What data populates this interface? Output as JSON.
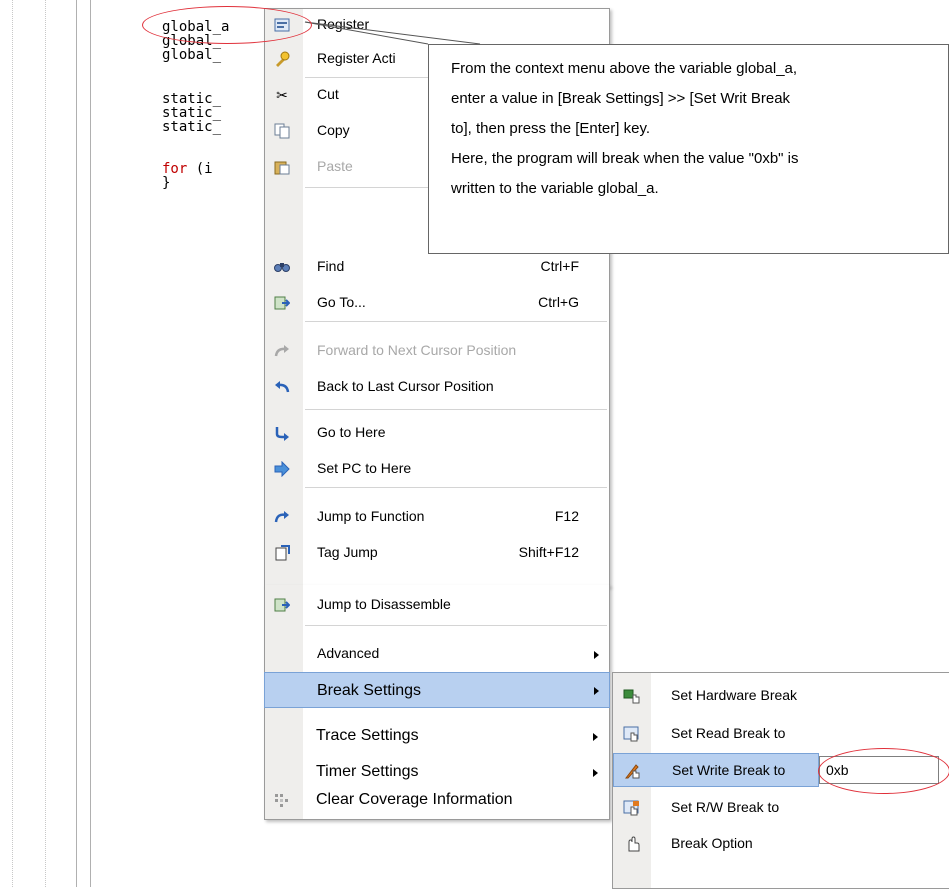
{
  "editor": {
    "code_lines": [
      "global_a",
      "global_",
      "global_",
      "",
      "static_",
      "static_",
      "static_",
      "",
      "for (i",
      "}"
    ],
    "for_keyword": "for",
    "for_rest": " (i"
  },
  "context_menu": {
    "items": [
      {
        "label": "Register",
        "shortcut": "",
        "icon": "register-watch-icon"
      },
      {
        "label": "Register Acti",
        "shortcut": "",
        "icon": "register-action-icon"
      },
      {
        "label": "Cut",
        "shortcut": "",
        "icon": "scissors-icon"
      },
      {
        "label": "Copy",
        "shortcut": "",
        "icon": "copy-icon"
      },
      {
        "label": "Paste",
        "shortcut": "",
        "icon": "paste-icon",
        "disabled": true
      },
      {
        "label": "Find",
        "shortcut": "Ctrl+F",
        "icon": "find-icon"
      },
      {
        "label": "Go To...",
        "shortcut": "Ctrl+G",
        "icon": "goto-icon"
      },
      {
        "label": "Forward to Next Cursor Position",
        "shortcut": "",
        "icon": "forward-arrow-icon",
        "disabled": true
      },
      {
        "label": "Back to Last Cursor Position",
        "shortcut": "",
        "icon": "back-arrow-icon"
      },
      {
        "label": "Go to Here",
        "shortcut": "",
        "icon": "go-here-icon"
      },
      {
        "label": "Set PC to Here",
        "shortcut": "",
        "icon": "set-pc-icon"
      },
      {
        "label": "Jump to Function",
        "shortcut": "F12",
        "icon": "jump-function-icon"
      },
      {
        "label": "Tag Jump",
        "shortcut": "Shift+F12",
        "icon": "tag-jump-icon"
      },
      {
        "label": "Jump to Disassemble",
        "shortcut": "",
        "icon": "disassemble-icon"
      },
      {
        "label": "Advanced",
        "shortcut": "",
        "icon": ""
      },
      {
        "label": "Break Settings",
        "shortcut": "",
        "icon": ""
      },
      {
        "label": "Trace Settings",
        "shortcut": "",
        "icon": ""
      },
      {
        "label": "Timer Settings",
        "shortcut": "",
        "icon": ""
      },
      {
        "label": "Clear Coverage Information",
        "shortcut": "",
        "icon": "clear-coverage-icon"
      }
    ]
  },
  "break_submenu": {
    "items": [
      {
        "label": "Set Hardware Break",
        "icon": "hardware-break-icon"
      },
      {
        "label": "Set Read Break to",
        "icon": "read-break-icon"
      },
      {
        "label": "Set Write Break to",
        "icon": "write-break-icon"
      },
      {
        "label": "Set R/W Break to",
        "icon": "rw-break-icon"
      },
      {
        "label": "Break Option",
        "icon": "break-option-icon"
      }
    ],
    "write_break_value": "0xb"
  },
  "callout": {
    "lines": [
      "From the context menu above the variable global_a,",
      "enter a value in [Break Settings] >> [Set Writ Break",
      "to], then press the [Enter] key.",
      "Here, the program will break when the value \"0xb\" is",
      "written to the variable global_a."
    ]
  },
  "colors": {
    "highlight_ellipse": "#e0303a",
    "selection_bg": "#b8d0f0",
    "keyword": "#c00000"
  }
}
